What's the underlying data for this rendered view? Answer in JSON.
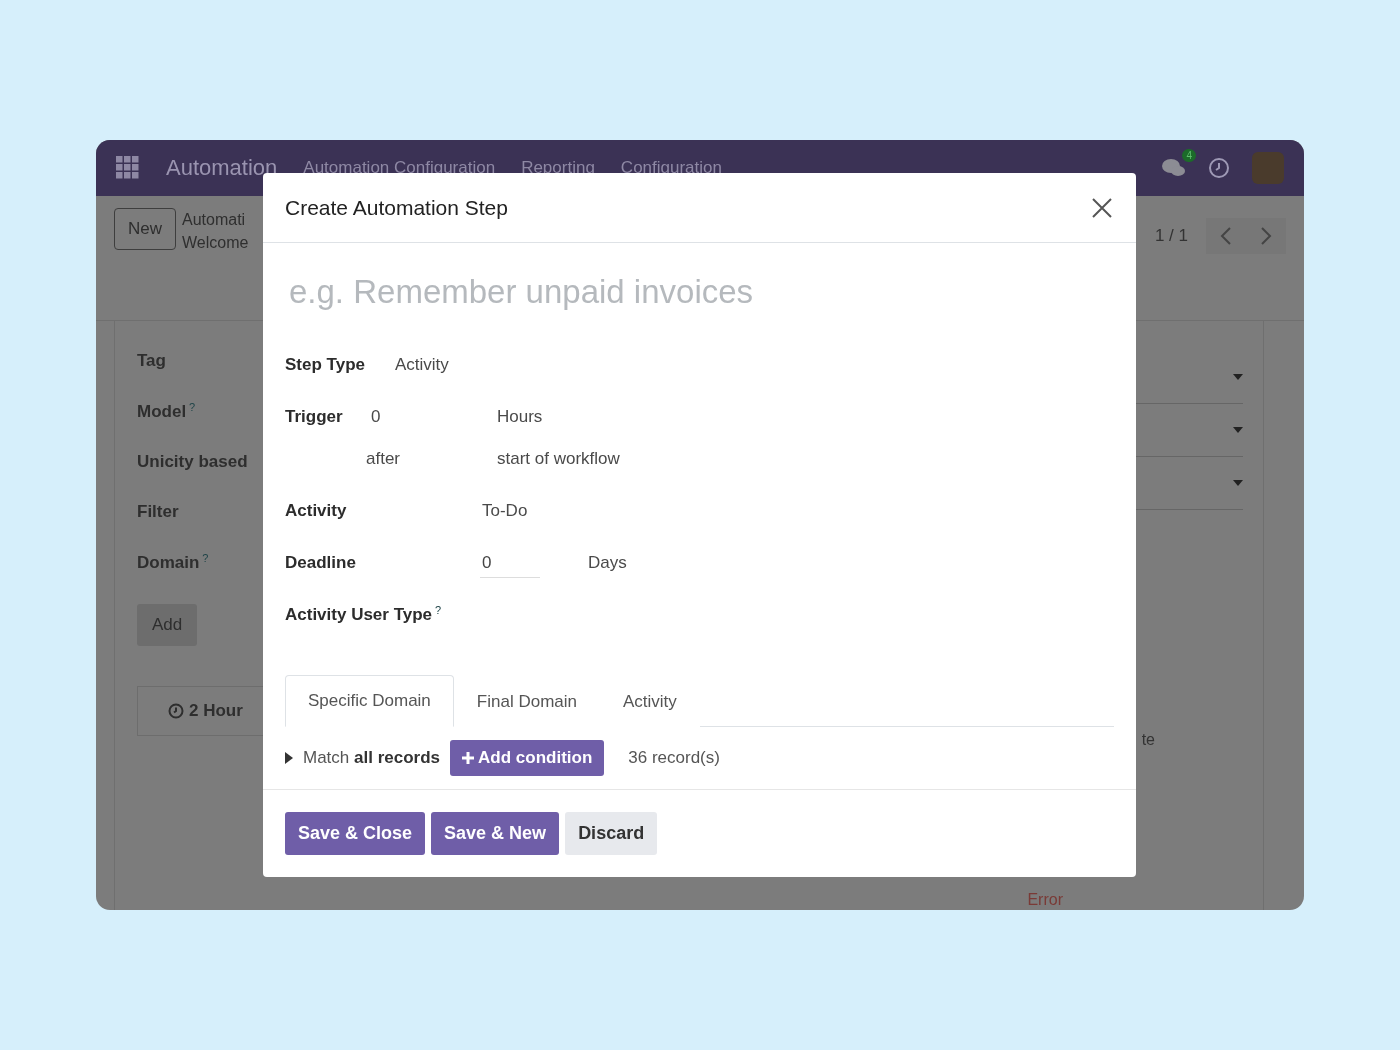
{
  "navbar": {
    "app_name": "Automation",
    "menu": [
      "Automation Configuration",
      "Reporting",
      "Configuration"
    ],
    "message_badge": "4"
  },
  "control_panel": {
    "new_button": "New",
    "breadcrumb": [
      "Automati",
      "Welcome"
    ],
    "pager": "1 / 1"
  },
  "form": {
    "labels": [
      {
        "text": "Tag"
      },
      {
        "text": "Model",
        "help": "?"
      },
      {
        "text": "Unicity based"
      },
      {
        "text": "Filter"
      },
      {
        "text": "Domain",
        "help": "?"
      }
    ],
    "add_button": "Add",
    "step_duration": "2 Hour",
    "column_text": "te",
    "error_text": "Error"
  },
  "dialog": {
    "title": "Create Automation Step",
    "name_placeholder": "e.g. Remember unpaid invoices",
    "step_type": {
      "label": "Step Type",
      "value": "Activity"
    },
    "trigger": {
      "label": "Trigger",
      "amount": "0",
      "unit": "Hours",
      "relation": "after",
      "event": "start of workflow"
    },
    "activity": {
      "label": "Activity",
      "value": "To-Do"
    },
    "deadline": {
      "label": "Deadline",
      "value": "0",
      "unit": "Days"
    },
    "user_type": {
      "label": "Activity User Type",
      "help": "?"
    },
    "tabs": [
      {
        "label": "Specific Domain",
        "selected": true
      },
      {
        "label": "Final Domain",
        "selected": false
      },
      {
        "label": "Activity",
        "selected": false
      }
    ],
    "domain": {
      "text": "Match **all records**",
      "add_condition": "Add condition",
      "count": "36 record(s)"
    },
    "buttons": [
      {
        "label": "Save & Close",
        "kind": "primary"
      },
      {
        "label": "Save & New",
        "kind": "primary"
      },
      {
        "label": "Discard",
        "kind": "secondary"
      }
    ]
  }
}
